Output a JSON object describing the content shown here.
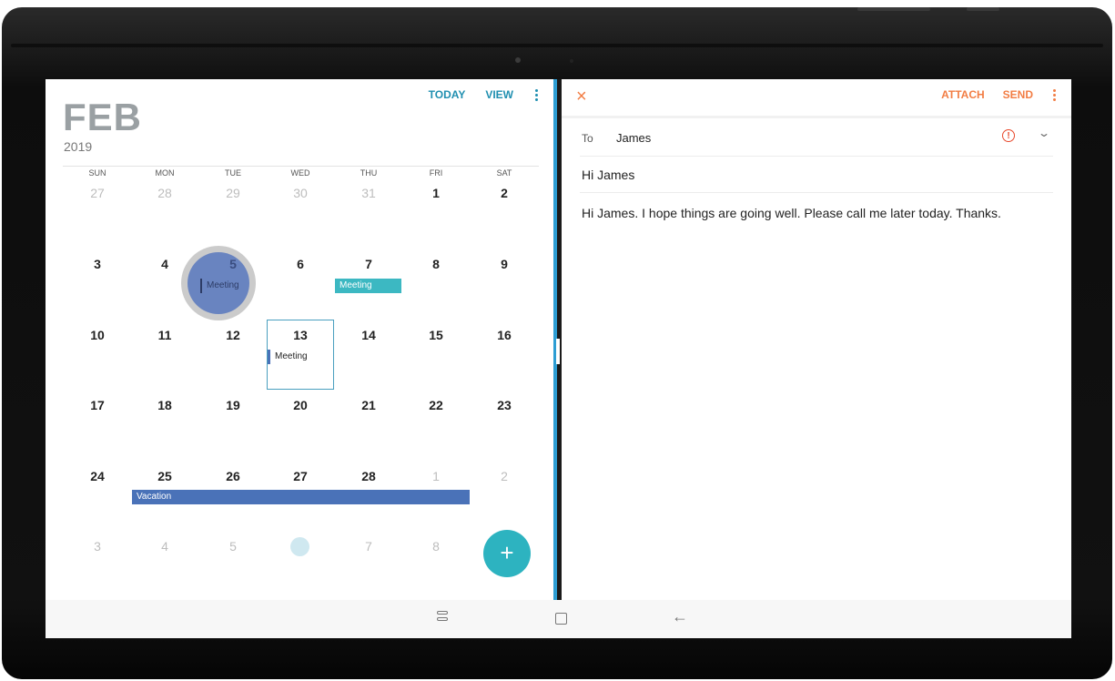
{
  "calendar": {
    "month": "FEB",
    "year": "2019",
    "actions": {
      "today": "TODAY",
      "view": "VIEW"
    },
    "weekdays": [
      "SUN",
      "MON",
      "TUE",
      "WED",
      "THU",
      "FRI",
      "SAT"
    ],
    "weeks": [
      [
        "27",
        "28",
        "29",
        "30",
        "31",
        "1",
        "2"
      ],
      [
        "3",
        "4",
        "5",
        "6",
        "7",
        "8",
        "9"
      ],
      [
        "10",
        "11",
        "12",
        "13",
        "14",
        "15",
        "16"
      ],
      [
        "17",
        "18",
        "19",
        "20",
        "21",
        "22",
        "23"
      ],
      [
        "24",
        "25",
        "26",
        "27",
        "28",
        "1",
        "2"
      ],
      [
        "3",
        "4",
        "5",
        "",
        "7",
        "8",
        ""
      ]
    ],
    "events": {
      "meeting_5": "Meeting",
      "meeting_7": "Meeting",
      "meeting_13": "Meeting",
      "vacation": "Vacation"
    },
    "add_symbol": "+"
  },
  "email": {
    "actions": {
      "attach": "ATTACH",
      "send": "SEND"
    },
    "to_label": "To",
    "to_value": "James",
    "subject": "Hi James",
    "body": "Hi James. I hope things are going well. Please call me later today. Thanks."
  },
  "icons": {
    "close": "×",
    "warning": "!",
    "chevron": "⌄",
    "back": "←"
  },
  "colors": {
    "calendar_accent": "#1f8fb0",
    "email_accent": "#f27d44",
    "event_blue": "#4a72b8",
    "event_teal": "#3cb8c2",
    "fab": "#2db3c0"
  }
}
